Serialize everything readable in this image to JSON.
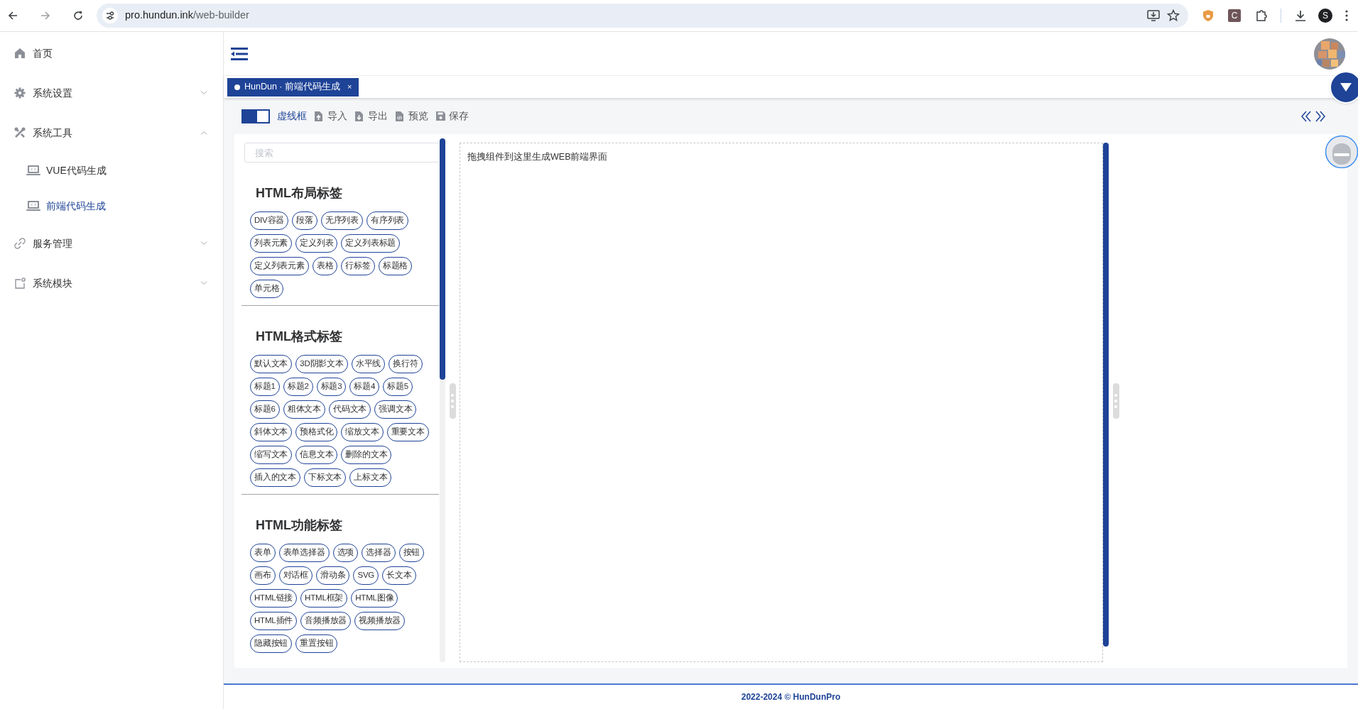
{
  "browser": {
    "url_host": "pro.hundun.ink",
    "url_path": "/web-builder",
    "profile_initial": "S",
    "extension_letter": "C"
  },
  "sidebar": {
    "items": [
      {
        "label": "首页",
        "selected": false
      },
      {
        "label": "系统设置",
        "selected": false,
        "expanded": false
      },
      {
        "label": "系统工具",
        "selected": false,
        "expanded": true,
        "children": [
          {
            "label": "VUE代码生成",
            "selected": false
          },
          {
            "label": "前端代码生成",
            "selected": true
          }
        ]
      },
      {
        "label": "服务管理",
        "selected": false,
        "expanded": false
      },
      {
        "label": "系统模块",
        "selected": false,
        "expanded": false
      }
    ]
  },
  "tabs": [
    {
      "label": "HunDun · 前端代码生成",
      "selected": true,
      "close": "×"
    }
  ],
  "toolbar": {
    "toggle": {
      "on": true
    },
    "toggle_label": "虚线框",
    "buttons": [
      "导入",
      "导出",
      "预览",
      "保存"
    ]
  },
  "palette": {
    "search": {
      "placeholder": "搜索"
    },
    "groups": [
      {
        "title": "HTML布局标签",
        "tags": [
          "DIV容器",
          "段落",
          "无序列表",
          "有序列表",
          "列表元素",
          "定义列表",
          "定义列表标题",
          "定义列表元素",
          "表格",
          "行标签",
          "标题格",
          "单元格"
        ]
      },
      {
        "title": "HTML格式标签",
        "tags": [
          "默认文本",
          "3D阴影文本",
          "水平线",
          "换行符",
          "标题1",
          "标题2",
          "标题3",
          "标题4",
          "标题5",
          "标题6",
          "粗体文本",
          "代码文本",
          "强调文本",
          "斜体文本",
          "预格式化",
          "缩放文本",
          "重要文本",
          "缩写文本",
          "信息文本",
          "删除的文本",
          "插入的文本",
          "下标文本",
          "上标文本"
        ]
      },
      {
        "title": "HTML功能标签",
        "tags": [
          "表单",
          "表单选择器",
          "选项",
          "选择器",
          "按钮",
          "画布",
          "对话框",
          "滑动条",
          "SVG",
          "长文本",
          "HTML链接",
          "HTML框架",
          "HTML图像",
          "HTML插件",
          "音频播放器",
          "视频播放器",
          "隐藏按钮",
          "重置按钮"
        ]
      }
    ]
  },
  "canvas": {
    "hint": "拖拽组件到这里生成WEB前端界面"
  },
  "footer": {
    "text": "2022-2024 © HunDunPro"
  }
}
